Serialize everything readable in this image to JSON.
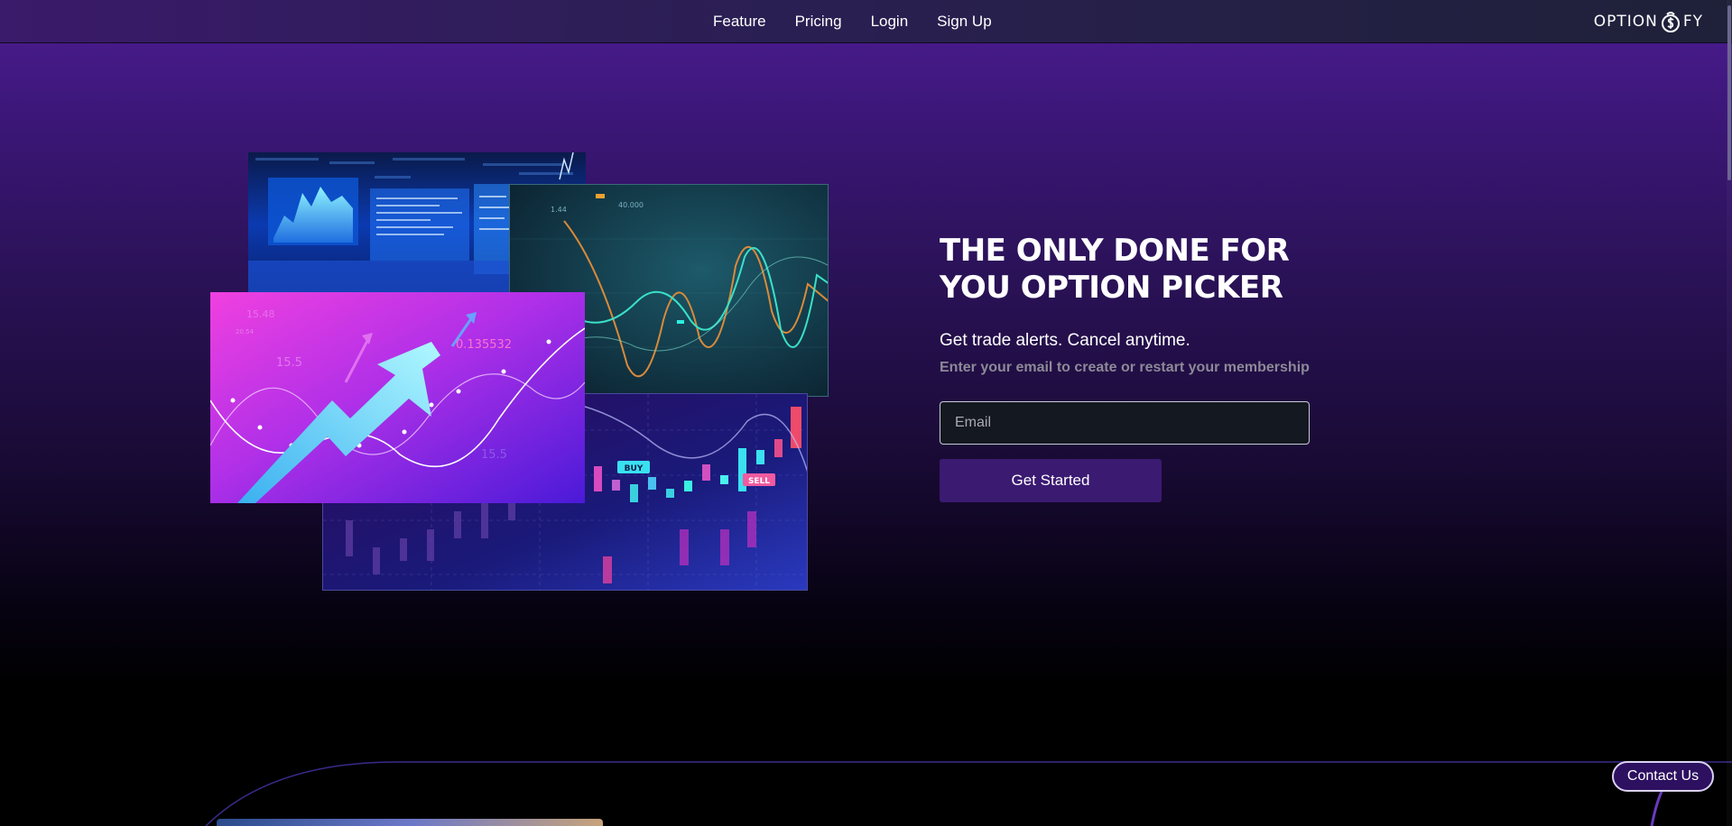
{
  "nav": {
    "links": [
      "Feature",
      "Pricing",
      "Login",
      "Sign Up"
    ],
    "logo_text_left": "OPTION",
    "logo_text_right": "FY"
  },
  "hero": {
    "title_line1": "THE ONLY DONE FOR",
    "title_line2": "YOU OPTION PICKER",
    "subtitle": "Get trade alerts. Cancel anytime.",
    "hint": "Enter your email to create or restart your membership",
    "email_placeholder": "Email",
    "email_value": "",
    "cta_label": "Get Started"
  },
  "collage": {
    "chart_labels": {
      "value_main": "0.135532",
      "value_a": "15.5",
      "value_b": "15.48",
      "value_c": "15.5",
      "value_d": "20.54",
      "buy": "BUY",
      "sell": "SELL",
      "teal_a": "1.44",
      "teal_b": "40.000"
    }
  },
  "contact": {
    "label": "Contact Us"
  },
  "colors": {
    "accent": "#3b1a72",
    "bg_top": "#4c1c92",
    "bg_bottom": "#000000",
    "input_bg": "#141821",
    "hint_text": "#8c8a97"
  },
  "icons": {
    "logo_mark": "dollar-bag-icon"
  }
}
